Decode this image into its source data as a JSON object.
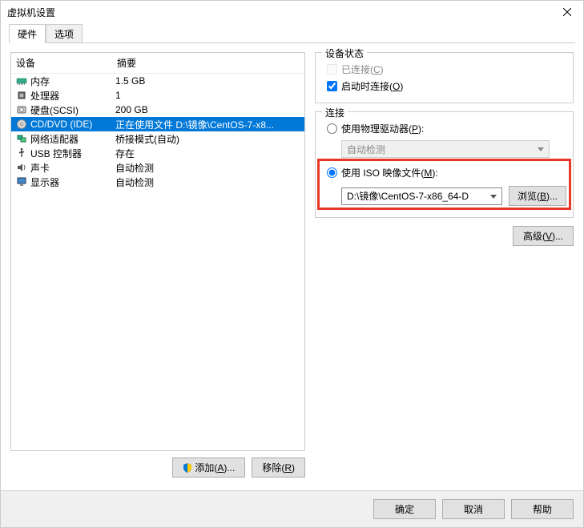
{
  "window": {
    "title": "虚拟机设置"
  },
  "tabs": {
    "hardware": "硬件",
    "options": "选项"
  },
  "table": {
    "col_device": "设备",
    "col_summary": "摘要",
    "rows": [
      {
        "name": "内存",
        "summary": "1.5 GB",
        "icon": "memory"
      },
      {
        "name": "处理器",
        "summary": "1",
        "icon": "cpu"
      },
      {
        "name": "硬盘(SCSI)",
        "summary": "200 GB",
        "icon": "disk"
      },
      {
        "name": "CD/DVD (IDE)",
        "summary": "正在使用文件 D:\\镜像\\CentOS-7-x8...",
        "icon": "cd",
        "selected": true
      },
      {
        "name": "网络适配器",
        "summary": "桥接模式(自动)",
        "icon": "net"
      },
      {
        "name": "USB 控制器",
        "summary": "存在",
        "icon": "usb"
      },
      {
        "name": "声卡",
        "summary": "自动检测",
        "icon": "sound"
      },
      {
        "name": "显示器",
        "summary": "自动检测",
        "icon": "display"
      }
    ]
  },
  "left_buttons": {
    "add": "添加(",
    "add_u": "A",
    "add_end": ")...",
    "remove": "移除(",
    "remove_u": "R",
    "remove_end": ")"
  },
  "status": {
    "legend": "设备状态",
    "connected": "已连接(",
    "connected_u": "C",
    "connected_end": ")",
    "connect_on_start": "启动时连接(",
    "connect_on_start_u": "O",
    "connect_on_start_end": ")"
  },
  "connection": {
    "legend": "连接",
    "physical": "使用物理驱动器(",
    "physical_u": "P",
    "physical_end": "):",
    "auto_detect": "自动检测",
    "use_iso": "使用 ISO 映像文件(",
    "use_iso_u": "M",
    "use_iso_end": "):",
    "iso_path": "D:\\镜像\\CentOS-7-x86_64-D",
    "browse": "浏览(",
    "browse_u": "B",
    "browse_end": ")..."
  },
  "advanced": {
    "label": "高级(",
    "u": "V",
    "end": ")..."
  },
  "footer": {
    "ok": "确定",
    "cancel": "取消",
    "help": "帮助"
  }
}
